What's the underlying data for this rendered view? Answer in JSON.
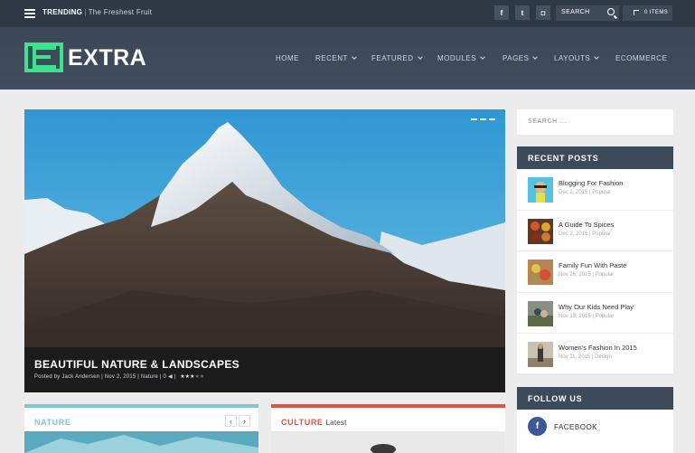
{
  "topbar": {
    "trending_label": "TRENDING",
    "trending_text": "The Freshest Fruit",
    "social": [
      {
        "name": "facebook-icon",
        "glyph": "f"
      },
      {
        "name": "twitter-icon",
        "glyph": "t"
      },
      {
        "name": "instagram-icon",
        "glyph": "◘"
      }
    ],
    "search_label": "SEARCH",
    "items_label": "0 ITEMS"
  },
  "header": {
    "logo_text": "EXTRA",
    "nav": [
      "HOME",
      "RECENT",
      "FEATURED",
      "MODULES",
      "PAGES",
      "LAYOUTS",
      "ECOMMERCE"
    ]
  },
  "featured": {
    "title": "BEAUTIFUL NATURE & LANDSCAPES",
    "meta": "Posted by Jack Andersen | Nov 2, 2015 | Nature | 0",
    "rating": 2.5
  },
  "cards": [
    {
      "title": "NATURE",
      "subtitle": "",
      "accent": "#7ec8d4"
    },
    {
      "title": "CULTURE",
      "subtitle": "Latest",
      "accent": "#e0553d"
    }
  ],
  "sidebar": {
    "search_placeholder": "SEARCH ...",
    "recent_title": "RECENT POSTS",
    "posts": [
      {
        "title": "Blogging For Fashion",
        "meta": "Dec 2, 2015 | Popular",
        "thumb": "fashion"
      },
      {
        "title": "A Guide To Spices",
        "meta": "Dec 2, 2015 | Popular",
        "thumb": "spices"
      },
      {
        "title": "Family Fun With Paste",
        "meta": "Nov 26, 2015 | Popular",
        "thumb": "paste"
      },
      {
        "title": "Why Our Kids Need Play",
        "meta": "Nov 13, 2015 | Popular",
        "thumb": "kids"
      },
      {
        "title": "Women's Fashion In 2015",
        "meta": "Nov 11, 2015 | Design",
        "thumb": "women"
      }
    ],
    "follow_title": "FOLLOW US",
    "follow": {
      "label": "FACEBOOK",
      "glyph": "f"
    }
  },
  "colors": {
    "accent_green": "#3de28e",
    "header": "#3b4757",
    "widget_header": "#3d4a5a"
  }
}
